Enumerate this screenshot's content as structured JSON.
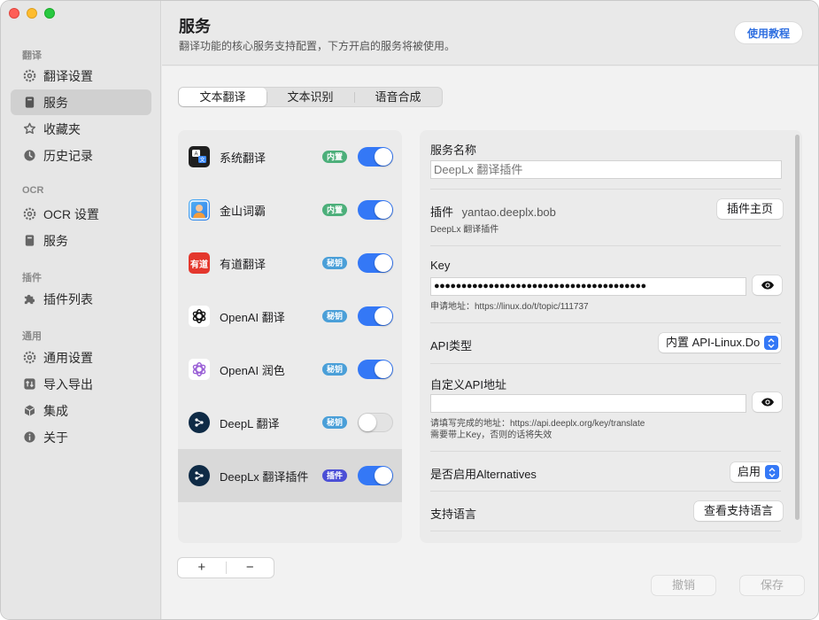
{
  "sidebar": {
    "sections": [
      {
        "label": "翻译",
        "items": [
          {
            "label": "翻译设置",
            "icon": "gear-icon"
          },
          {
            "label": "服务",
            "icon": "book-icon",
            "active": true
          },
          {
            "label": "收藏夹",
            "icon": "star-icon"
          },
          {
            "label": "历史记录",
            "icon": "clock-icon"
          }
        ]
      },
      {
        "label": "OCR",
        "items": [
          {
            "label": "OCR 设置",
            "icon": "gear-icon"
          },
          {
            "label": "服务",
            "icon": "book-icon"
          }
        ]
      },
      {
        "label": "插件",
        "items": [
          {
            "label": "插件列表",
            "icon": "puzzle-icon"
          }
        ]
      },
      {
        "label": "通用",
        "items": [
          {
            "label": "通用设置",
            "icon": "gear-icon"
          },
          {
            "label": "导入导出",
            "icon": "import-export-icon"
          },
          {
            "label": "集成",
            "icon": "cube-icon"
          },
          {
            "label": "关于",
            "icon": "info-icon"
          }
        ]
      }
    ]
  },
  "header": {
    "title": "服务",
    "subtitle": "翻译功能的核心服务支持配置，下方开启的服务将被使用。",
    "tutorial_label": "使用教程"
  },
  "tabs": [
    {
      "label": "文本翻译",
      "active": true
    },
    {
      "label": "文本识别",
      "active": false
    },
    {
      "label": "语音合成",
      "active": false
    }
  ],
  "services": [
    {
      "name": "系统翻译",
      "badge": "内置",
      "badge_color": "#4caf7a",
      "enabled": true,
      "icon": "system-translate-icon"
    },
    {
      "name": "金山词霸",
      "badge": "内置",
      "badge_color": "#4caf7a",
      "enabled": true,
      "icon": "iciba-icon"
    },
    {
      "name": "有道翻译",
      "badge": "秘钥",
      "badge_color": "#4a9fd8",
      "enabled": true,
      "icon": "youdao-icon",
      "icon_text": "有道"
    },
    {
      "name": "OpenAI 翻译",
      "badge": "秘钥",
      "badge_color": "#4a9fd8",
      "enabled": true,
      "icon": "openai-icon"
    },
    {
      "name": "OpenAI 润色",
      "badge": "秘钥",
      "badge_color": "#4a9fd8",
      "enabled": true,
      "icon": "openai-purple-icon"
    },
    {
      "name": "DeepL 翻译",
      "badge": "秘钥",
      "badge_color": "#4a9fd8",
      "enabled": false,
      "icon": "deepl-icon"
    },
    {
      "name": "DeepLx 翻译插件",
      "badge": "插件",
      "badge_color": "#4b4fd6",
      "enabled": true,
      "icon": "deeplx-icon",
      "active": true
    }
  ],
  "list_controls": {
    "add": "+",
    "remove": "−"
  },
  "detail": {
    "service_name_label": "服务名称",
    "service_name_placeholder": "DeepLx 翻译插件",
    "plugin_label": "插件",
    "plugin_id": "yantao.deeplx.bob",
    "plugin_desc": "DeepLx 翻译插件",
    "plugin_home_button": "插件主页",
    "key_label": "Key",
    "key_value": "●●●●●●●●●●●●●●●●●●●●●●●●●●●●●●●●●●●●●●●",
    "key_hint": "申请地址：https://linux.do/t/topic/111737",
    "api_type_label": "API类型",
    "api_type_value": "内置 API-Linux.Do",
    "custom_api_label": "自定义API地址",
    "custom_api_value": "",
    "custom_api_hint_1": "请填写完成的地址：https://api.deeplx.org/key/translate",
    "custom_api_hint_2": "需要带上Key，否则的话将失效",
    "alternatives_label": "是否启用Alternatives",
    "alternatives_value": "启用",
    "languages_label": "支持语言",
    "languages_button": "查看支持语言"
  },
  "footer": {
    "revert": "撤销",
    "save": "保存"
  }
}
